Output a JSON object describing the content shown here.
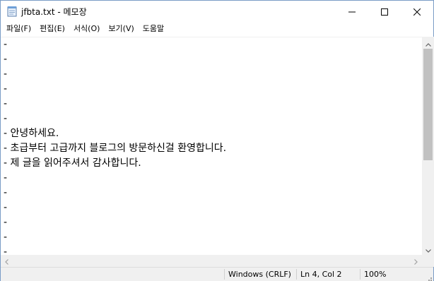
{
  "window": {
    "title": "jfbta.txt - 메모장"
  },
  "menu": {
    "items": [
      "파일(F)",
      "편집(E)",
      "서식(O)",
      "보기(V)",
      "도움말"
    ]
  },
  "editor": {
    "lines": [
      "-",
      "-",
      "-",
      "-",
      "-",
      "-",
      "- 안녕하세요.",
      "- 초급부터 고급까지 블로그의 방문하신걸 환영합니다.",
      "- 제 글을 읽어주셔서 감사합니다.",
      "-",
      "-",
      "-",
      "-",
      "-",
      "-"
    ]
  },
  "status": {
    "encoding": "Windows (CRLF)",
    "position": "Ln 4, Col 2",
    "zoom": "100%"
  },
  "icons": {
    "app": "notepad-icon",
    "minimize": "minimize-icon",
    "maximize": "maximize-icon",
    "close": "close-icon"
  },
  "colors": {
    "scroll_track": "#f0f0f0",
    "scroll_thumb": "#c1c1c1",
    "window_border": "#7a9cc6"
  }
}
